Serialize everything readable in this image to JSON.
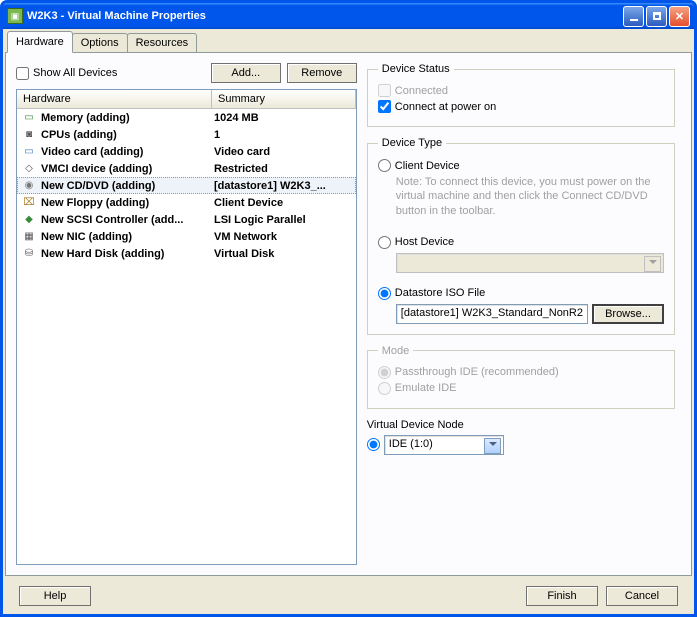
{
  "window": {
    "title": "W2K3 - Virtual Machine Properties"
  },
  "tabs": [
    "Hardware",
    "Options",
    "Resources"
  ],
  "activeTab": 0,
  "showAllDevices": {
    "label": "Show All Devices",
    "checked": false
  },
  "buttons": {
    "add": "Add...",
    "remove": "Remove",
    "browse": "Browse...",
    "help": "Help",
    "finish": "Finish",
    "cancel": "Cancel"
  },
  "hwTable": {
    "headers": {
      "hardware": "Hardware",
      "summary": "Summary"
    },
    "rows": [
      {
        "icon": "memory-icon",
        "iconColor": "#3a8b3a",
        "name": "Memory (adding)",
        "summary": "1024 MB",
        "selected": false
      },
      {
        "icon": "cpu-icon",
        "iconColor": "#555",
        "name": "CPUs (adding)",
        "summary": "1",
        "selected": false
      },
      {
        "icon": "video-icon",
        "iconColor": "#3a7bbf",
        "name": "Video card  (adding)",
        "summary": "Video card",
        "selected": false
      },
      {
        "icon": "vmci-icon",
        "iconColor": "#555",
        "name": "VMCI device (adding)",
        "summary": "Restricted",
        "selected": false
      },
      {
        "icon": "cd-icon",
        "iconColor": "#777",
        "name": "New CD/DVD (adding)",
        "summary": "[datastore1] W2K3_...",
        "selected": true
      },
      {
        "icon": "floppy-icon",
        "iconColor": "#b08030",
        "name": "New Floppy (adding)",
        "summary": "Client Device",
        "selected": false
      },
      {
        "icon": "scsi-icon",
        "iconColor": "#3a8b3a",
        "name": "New SCSI Controller (add...",
        "summary": "LSI Logic Parallel",
        "selected": false
      },
      {
        "icon": "nic-icon",
        "iconColor": "#555",
        "name": "New NIC (adding)",
        "summary": "VM Network",
        "selected": false
      },
      {
        "icon": "disk-icon",
        "iconColor": "#555",
        "name": "New Hard Disk (adding)",
        "summary": "Virtual Disk",
        "selected": false
      }
    ]
  },
  "deviceStatus": {
    "legend": "Device Status",
    "connected": {
      "label": "Connected",
      "checked": false,
      "enabled": false
    },
    "connectAtPowerOn": {
      "label": "Connect at power on",
      "checked": true,
      "enabled": true
    }
  },
  "deviceType": {
    "legend": "Device Type",
    "selected": "datastore",
    "client": {
      "label": "Client Device",
      "note": "Note: To connect this device, you must power on the virtual machine and then click the Connect CD/DVD button in the toolbar."
    },
    "host": {
      "label": "Host Device",
      "value": ""
    },
    "datastore": {
      "label": "Datastore ISO File",
      "value": "[datastore1] W2K3_Standard_NonR2"
    }
  },
  "mode": {
    "legend": "Mode",
    "enabled": false,
    "selected": "passthrough",
    "passthrough": "Passthrough IDE (recommended)",
    "emulate": "Emulate IDE"
  },
  "virtualDeviceNode": {
    "label": "Virtual Device Node",
    "value": "IDE (1:0)"
  }
}
